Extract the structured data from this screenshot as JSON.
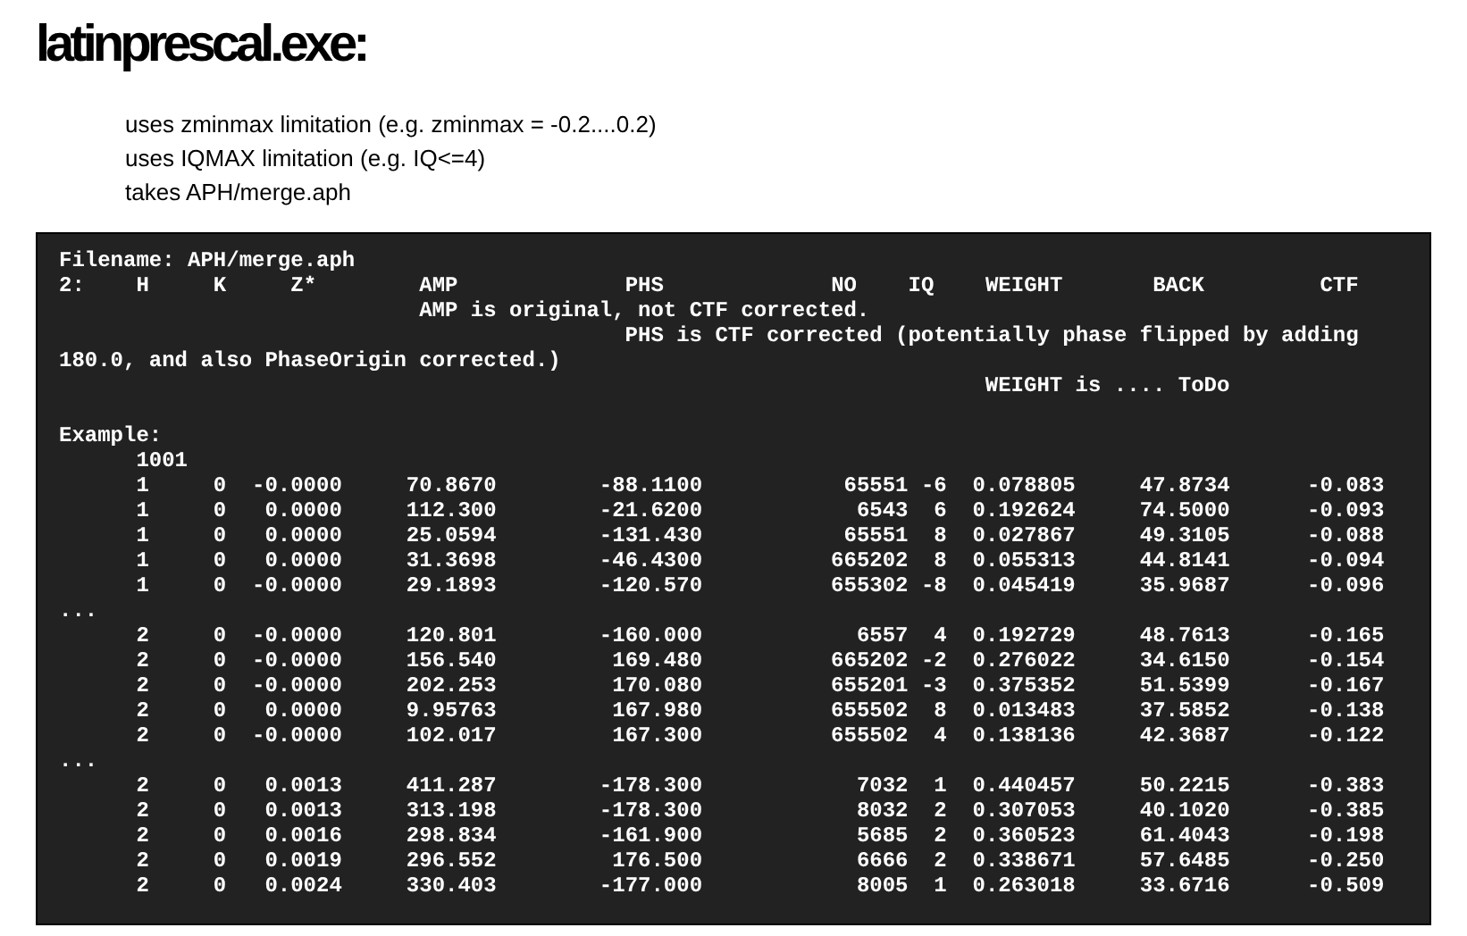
{
  "title": "latinprescal.exe:",
  "notes": [
    "uses zminmax limitation (e.g. zminmax = -0.2....0.2)",
    "uses IQMAX limitation (e.g. IQ<=4)",
    "takes APH/merge.aph"
  ],
  "terminal": {
    "filename": "Filename: APH/merge.aph",
    "header_label": "2:",
    "columns": [
      {
        "label": "H"
      },
      {
        "label": "K"
      },
      {
        "label": "Z*"
      },
      {
        "label": "AMP",
        "note": [
          "AMP is original, not CTF corrected."
        ]
      },
      {
        "label": "PHS",
        "note": [
          "PHS is CTF corrected (potentially phase flipped by adding",
          "180.0, and also PhaseOrigin corrected.)"
        ]
      },
      {
        "label": "NO"
      },
      {
        "label": "IQ"
      },
      {
        "label": "WEIGHT",
        "note": [
          "WEIGHT is .... ToDo"
        ]
      },
      {
        "label": "BACK"
      },
      {
        "label": "CTF"
      }
    ],
    "example_label": "Example:",
    "lines": [
      {
        "kind": "id",
        "text": "1001"
      },
      {
        "kind": "row",
        "cells": [
          "1",
          "0",
          "-0.0000",
          "70.8670",
          "-88.1100",
          "65551",
          "-6",
          "0.078805",
          "47.8734",
          "-0.083"
        ]
      },
      {
        "kind": "row",
        "cells": [
          "1",
          "0",
          "0.0000",
          "112.300",
          "-21.6200",
          "6543",
          "6",
          "0.192624",
          "74.5000",
          "-0.093"
        ]
      },
      {
        "kind": "row",
        "cells": [
          "1",
          "0",
          "0.0000",
          "25.0594",
          "-131.430",
          "65551",
          "8",
          "0.027867",
          "49.3105",
          "-0.088"
        ]
      },
      {
        "kind": "row",
        "cells": [
          "1",
          "0",
          "0.0000",
          "31.3698",
          "-46.4300",
          "665202",
          "8",
          "0.055313",
          "44.8141",
          "-0.094"
        ]
      },
      {
        "kind": "row",
        "cells": [
          "1",
          "0",
          "-0.0000",
          "29.1893",
          "-120.570",
          "655302",
          "-8",
          "0.045419",
          "35.9687",
          "-0.096"
        ]
      },
      {
        "kind": "ellipsis",
        "text": "..."
      },
      {
        "kind": "row",
        "cells": [
          "2",
          "0",
          "-0.0000",
          "120.801",
          "-160.000",
          "6557",
          "4",
          "0.192729",
          "48.7613",
          "-0.165"
        ]
      },
      {
        "kind": "row",
        "cells": [
          "2",
          "0",
          "-0.0000",
          "156.540",
          "169.480",
          "665202",
          "-2",
          "0.276022",
          "34.6150",
          "-0.154"
        ]
      },
      {
        "kind": "row",
        "cells": [
          "2",
          "0",
          "-0.0000",
          "202.253",
          "170.080",
          "655201",
          "-3",
          "0.375352",
          "51.5399",
          "-0.167"
        ]
      },
      {
        "kind": "row",
        "cells": [
          "2",
          "0",
          "0.0000",
          "9.95763",
          "167.980",
          "655502",
          "8",
          "0.013483",
          "37.5852",
          "-0.138"
        ]
      },
      {
        "kind": "row",
        "cells": [
          "2",
          "0",
          "-0.0000",
          "102.017",
          "167.300",
          "655502",
          "4",
          "0.138136",
          "42.3687",
          "-0.122"
        ]
      },
      {
        "kind": "ellipsis",
        "text": "..."
      },
      {
        "kind": "row",
        "cells": [
          "2",
          "0",
          "0.0013",
          "411.287",
          "-178.300",
          "7032",
          "1",
          "0.440457",
          "50.2215",
          "-0.383"
        ]
      },
      {
        "kind": "row",
        "cells": [
          "2",
          "0",
          "0.0013",
          "313.198",
          "-178.300",
          "8032",
          "2",
          "0.307053",
          "40.1020",
          "-0.385"
        ]
      },
      {
        "kind": "row",
        "cells": [
          "2",
          "0",
          "0.0016",
          "298.834",
          "-161.900",
          "5685",
          "2",
          "0.360523",
          "61.4043",
          "-0.198"
        ]
      },
      {
        "kind": "row",
        "cells": [
          "2",
          "0",
          "0.0019",
          "296.552",
          "176.500",
          "6666",
          "2",
          "0.338671",
          "57.6485",
          "-0.250"
        ]
      },
      {
        "kind": "row",
        "cells": [
          "2",
          "0",
          "0.0024",
          "330.403",
          "-177.000",
          "8005",
          "1",
          "0.263018",
          "33.6716",
          "-0.509"
        ]
      }
    ]
  }
}
